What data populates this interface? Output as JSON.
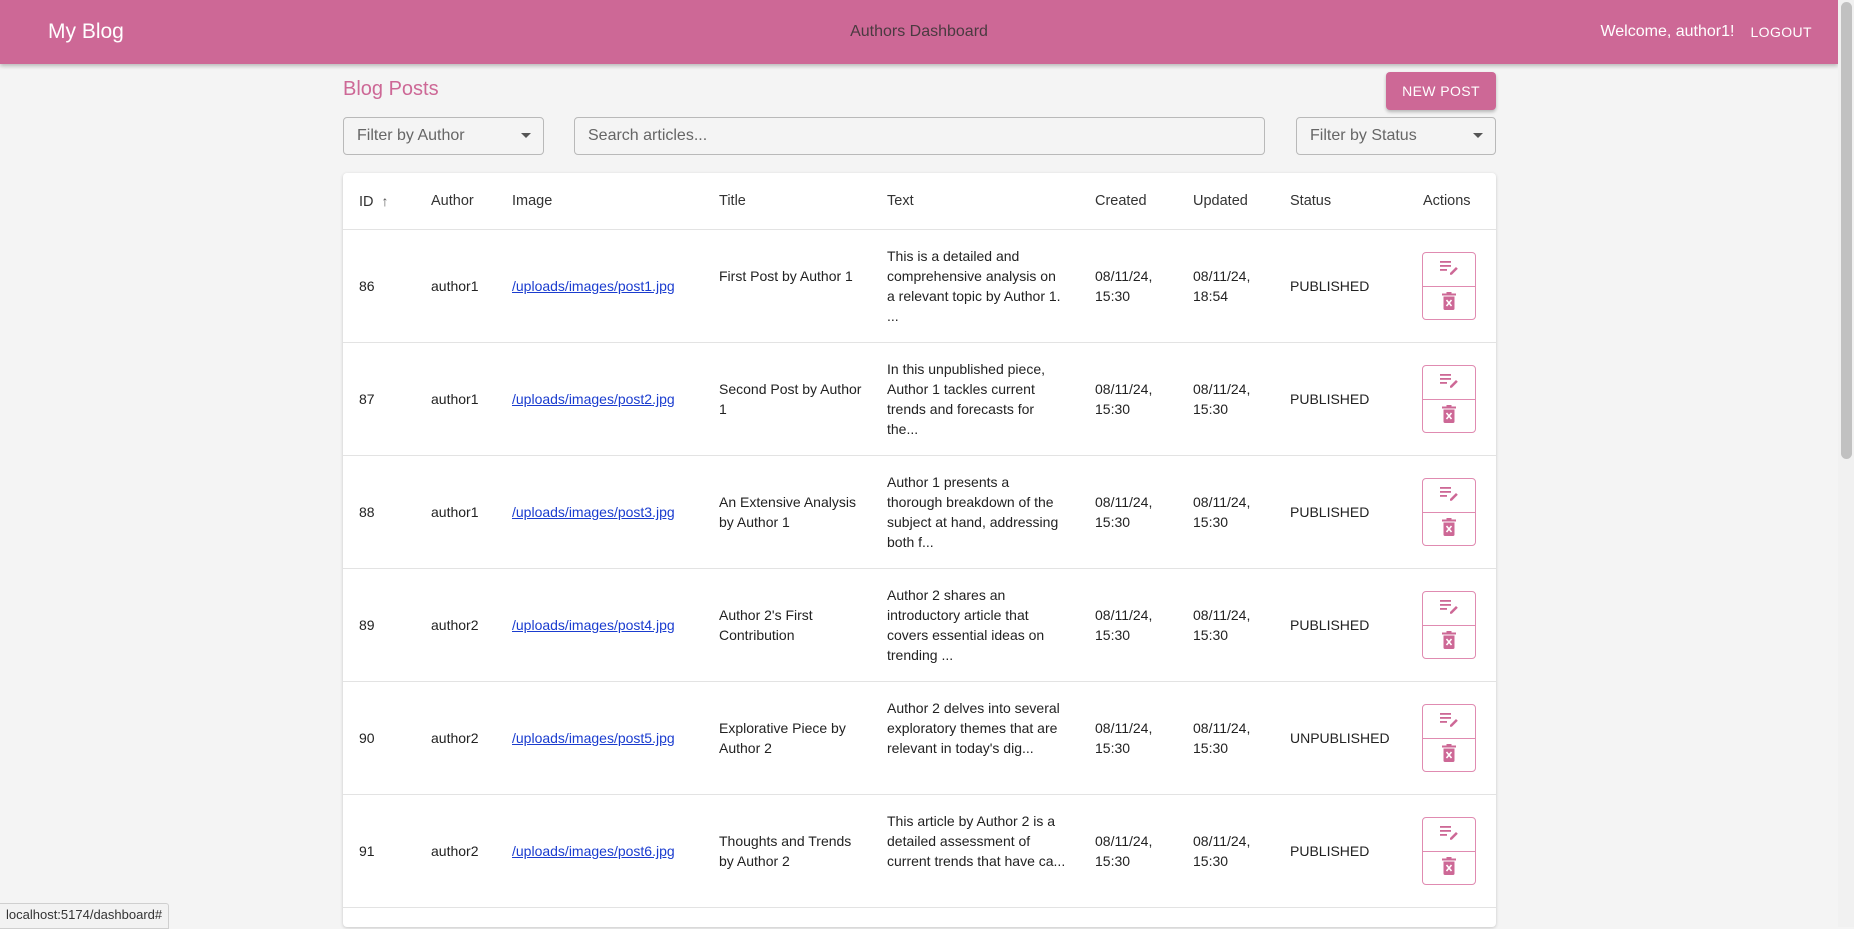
{
  "app": {
    "brand": "My Blog",
    "center_title": "Authors Dashboard",
    "welcome": "Welcome, author1!",
    "logout": "LOGOUT",
    "accent_color": "#cd6896"
  },
  "page": {
    "title": "Blog Posts",
    "new_post": "NEW POST"
  },
  "filters": {
    "author_label": "Filter by Author",
    "search_placeholder": "Search articles...",
    "status_label": "Filter by Status"
  },
  "table": {
    "headers": {
      "id": "ID",
      "author": "Author",
      "image": "Image",
      "title": "Title",
      "text": "Text",
      "created": "Created",
      "updated": "Updated",
      "status": "Status",
      "actions": "Actions"
    },
    "sort_icon": "arrow-up-icon",
    "rows": [
      {
        "id": "86",
        "author": "author1",
        "image": "/uploads/images/post1.jpg",
        "title": "First Post by Author 1",
        "text": "This is a detailed and comprehensive analysis on a relevant topic by Author 1. ...",
        "created": "08/11/24, 15:30",
        "updated": "08/11/24, 18:54",
        "status": "PUBLISHED"
      },
      {
        "id": "87",
        "author": "author1",
        "image": "/uploads/images/post2.jpg",
        "title": "Second Post by Author 1",
        "text": "In this unpublished piece, Author 1 tackles current trends and forecasts for the...",
        "created": "08/11/24, 15:30",
        "updated": "08/11/24, 15:30",
        "status": "PUBLISHED"
      },
      {
        "id": "88",
        "author": "author1",
        "image": "/uploads/images/post3.jpg",
        "title": "An Extensive Analysis by Author 1",
        "text": "Author 1 presents a thorough breakdown of the subject at hand, addressing both f...",
        "created": "08/11/24, 15:30",
        "updated": "08/11/24, 15:30",
        "status": "PUBLISHED"
      },
      {
        "id": "89",
        "author": "author2",
        "image": "/uploads/images/post4.jpg",
        "title": "Author 2's First Contribution",
        "text": "Author 2 shares an introductory article that covers essential ideas on trending ...",
        "created": "08/11/24, 15:30",
        "updated": "08/11/24, 15:30",
        "status": "PUBLISHED"
      },
      {
        "id": "90",
        "author": "author2",
        "image": "/uploads/images/post5.jpg",
        "title": "Explorative Piece by Author 2",
        "text": "Author 2 delves into several exploratory themes that are relevant in today's dig...",
        "created": "08/11/24, 15:30",
        "updated": "08/11/24, 15:30",
        "status": "UNPUBLISHED"
      },
      {
        "id": "91",
        "author": "author2",
        "image": "/uploads/images/post6.jpg",
        "title": "Thoughts and Trends by Author 2",
        "text": "This article by Author 2 is a detailed assessment of current trends that have ca...",
        "created": "08/11/24, 15:30",
        "updated": "08/11/24, 15:30",
        "status": "PUBLISHED"
      }
    ],
    "edit_icon": "edit-post-icon",
    "delete_icon": "delete-icon"
  },
  "browser": {
    "status_url": "localhost:5174/dashboard#"
  }
}
